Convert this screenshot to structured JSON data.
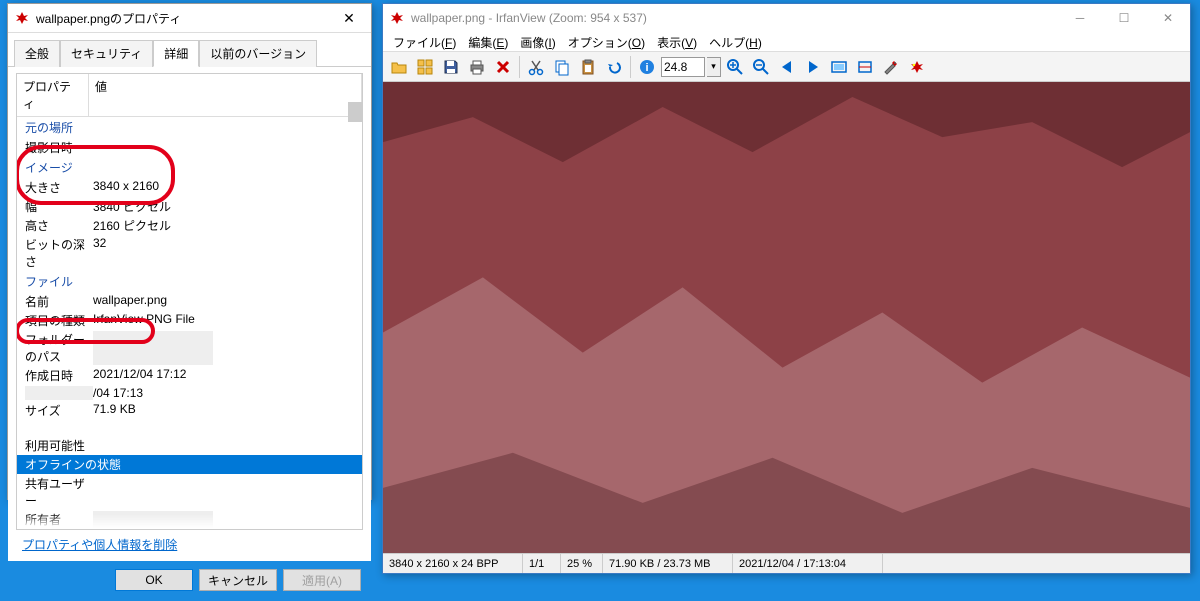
{
  "props": {
    "title": "wallpaper.pngのプロパティ",
    "tabs": [
      "全般",
      "セキュリティ",
      "詳細",
      "以前のバージョン"
    ],
    "active_tab": 2,
    "header": {
      "prop": "プロパティ",
      "val": "値"
    },
    "sections": {
      "origin": "元の場所",
      "image": "イメージ",
      "file": "ファイル"
    },
    "rows": {
      "shot_date": {
        "n": "撮影日時",
        "v": ""
      },
      "dim": {
        "n": "大きさ",
        "v": "3840 x 2160"
      },
      "width": {
        "n": "幅",
        "v": "3840 ピクセル"
      },
      "height": {
        "n": "高さ",
        "v": "2160 ピクセル"
      },
      "bit": {
        "n": "ビットの深さ",
        "v": "32"
      },
      "name": {
        "n": "名前",
        "v": "wallpaper.png"
      },
      "type": {
        "n": "項目の種類",
        "v": "IrfanView PNG File"
      },
      "folder": {
        "n": "フォルダーのパス",
        "v": ""
      },
      "created": {
        "n": "作成日時",
        "v": "2021/12/04 17:12"
      },
      "modified": {
        "n": "",
        "v": "/04 17:13"
      },
      "size": {
        "n": "サイズ",
        "v": "71.9 KB"
      },
      "blank": {
        "n": "",
        "v": ""
      },
      "avail": {
        "n": "利用可能性",
        "v": ""
      },
      "offline": {
        "n": "オフラインの状態",
        "v": ""
      },
      "shared": {
        "n": "共有ユーザー",
        "v": ""
      },
      "owner": {
        "n": "所有者",
        "v": ""
      }
    },
    "link": "プロパティや個人情報を削除",
    "buttons": {
      "ok": "OK",
      "cancel": "キャンセル",
      "apply": "適用(A)"
    }
  },
  "iv": {
    "title": "wallpaper.png - IrfanView (Zoom: 954 x 537)",
    "menus": [
      {
        "t": "ファイル",
        "k": "F"
      },
      {
        "t": "編集",
        "k": "E"
      },
      {
        "t": "画像",
        "k": "I"
      },
      {
        "t": "オプション",
        "k": "O"
      },
      {
        "t": "表示",
        "k": "V"
      },
      {
        "t": "ヘルプ",
        "k": "H"
      }
    ],
    "zoom": "24.8",
    "status": {
      "dim": "3840 x 2160 x 24 BPP",
      "page": "1/1",
      "zoom": "25 %",
      "size": "71.90 KB / 23.73 MB",
      "date": "2021/12/04 / 17:13:04"
    },
    "colors": {
      "dark": "#6e2f34",
      "mid": "#8d4147",
      "light": "#a6676c"
    }
  }
}
